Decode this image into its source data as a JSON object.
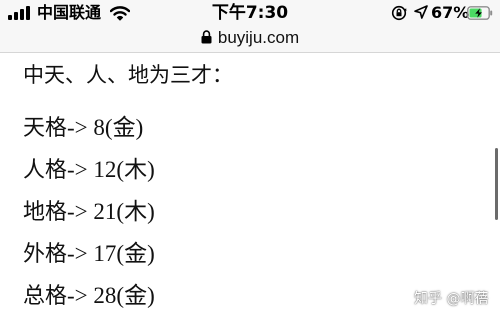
{
  "status_bar": {
    "carrier": "中国联通",
    "time": "下午7:30",
    "battery_percent": "67%",
    "battery_level": 0.67,
    "icons": [
      "signal-icon",
      "wifi-icon",
      "orientation-lock-icon",
      "location-arrow-icon",
      "battery-charging-icon"
    ]
  },
  "browser": {
    "url": "buyiju.com",
    "lock_icon": "lock-icon"
  },
  "content": {
    "intro": "中天、人、地为三才：",
    "rows": [
      {
        "label": "天格",
        "arrow": "->",
        "value": " 8(金)"
      },
      {
        "label": "人格",
        "arrow": "->",
        "value": " 12(木)"
      },
      {
        "label": "地格",
        "arrow": "->",
        "value": " 21(木)"
      },
      {
        "label": "外格",
        "arrow": "->",
        "value": " 17(金)"
      },
      {
        "label": "总格",
        "arrow": "->",
        "value": " 28(金)"
      }
    ]
  },
  "watermark": "知乎 @啊蓓",
  "colors": {
    "battery_green": "#4cd964",
    "bar_background": "#f7f7f7",
    "text": "#111111"
  }
}
